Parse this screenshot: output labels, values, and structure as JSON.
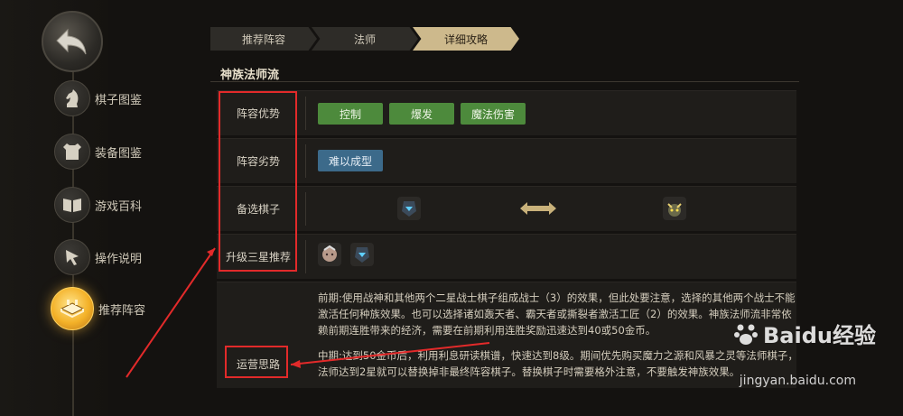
{
  "nav": {
    "items": [
      {
        "label": "棋子图鉴",
        "icon": "knight-icon"
      },
      {
        "label": "装备图鉴",
        "icon": "armor-icon"
      },
      {
        "label": "游戏百科",
        "icon": "book-icon"
      },
      {
        "label": "操作说明",
        "icon": "cursor-icon"
      },
      {
        "label": "推荐阵容",
        "icon": "board-icon",
        "active": true
      }
    ]
  },
  "tabs": [
    {
      "label": "推荐阵容"
    },
    {
      "label": "法师"
    },
    {
      "label": "详细攻略",
      "active": true
    }
  ],
  "section": {
    "title": "神族法师流"
  },
  "rows": {
    "advantage": {
      "label": "阵容优势",
      "tags": [
        "控制",
        "爆发",
        "魔法伤害"
      ]
    },
    "disadvantage": {
      "label": "阵容劣势",
      "tags": [
        "难以成型"
      ]
    },
    "alternates": {
      "label": "备选棋子"
    },
    "upgrade": {
      "label": "升级三星推荐"
    },
    "strategy": {
      "label": "运营思路",
      "early": "前期:使用战神和其他两个二星战士棋子组成战士（3）的效果，但此处要注意，选择的其他两个战士不能激活任何种族效果。也可以选择诸如轰天者、霸天者或撕裂者激活工匠（2）的效果。神族法师流非常依赖前期连胜带来的经济，需要在前期利用连胜奖励迅速达到40或50金币。",
      "mid": "中期:达到50金币后，利用利息研读棋谱，快速达到8级。期间优先购买魔力之源和风暴之灵等法师棋子，法师达到2星就可以替换掉非最终阵容棋子。替换棋子时需要格外注意，不要触发神族效果。"
    }
  },
  "watermark": {
    "brand": "Baidu经验",
    "url": "jingyan.baidu.com"
  },
  "colors": {
    "accent_gold": "#f3b128",
    "tag_green": "#4d8a3c",
    "tag_blue": "#3c6a8a",
    "annotation_red": "#e22a2a"
  }
}
